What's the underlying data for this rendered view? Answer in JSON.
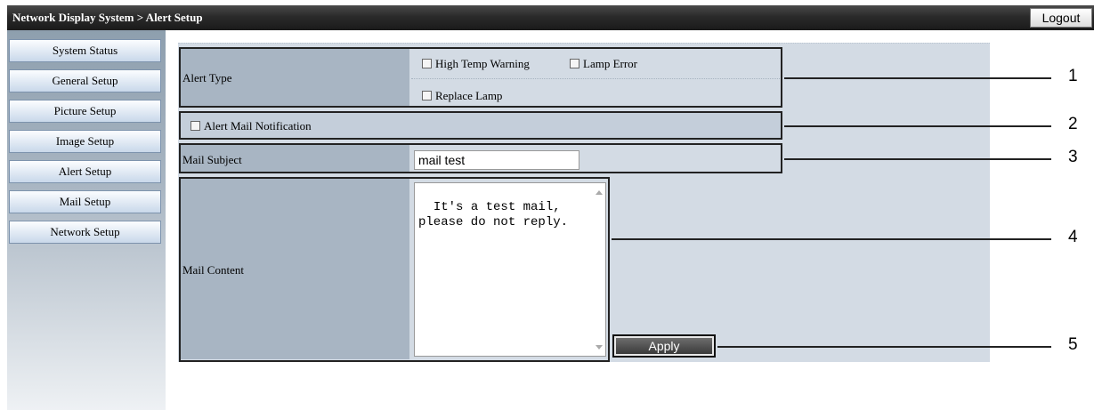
{
  "header": {
    "title": "Network Display System > Alert Setup",
    "logout_label": "Logout"
  },
  "sidebar": {
    "items": [
      {
        "label": "System Status"
      },
      {
        "label": "General Setup"
      },
      {
        "label": "Picture Setup"
      },
      {
        "label": "Image Setup"
      },
      {
        "label": "Alert Setup"
      },
      {
        "label": "Mail Setup"
      },
      {
        "label": "Network Setup"
      }
    ]
  },
  "form": {
    "alert_type_label": "Alert Type",
    "alert_options": [
      {
        "label": "High Temp Warning",
        "checked": false
      },
      {
        "label": "Lamp Error",
        "checked": false
      },
      {
        "label": "Replace Lamp",
        "checked": false
      }
    ],
    "alert_mail_notification_label": "Alert Mail Notification",
    "mail_subject_label": "Mail Subject",
    "mail_subject_value": "mail test",
    "mail_content_label": "Mail Content",
    "mail_content_value": "It's a test mail,\nplease do not reply.",
    "apply_label": "Apply"
  },
  "callouts": [
    "1",
    "2",
    "3",
    "4",
    "5"
  ]
}
